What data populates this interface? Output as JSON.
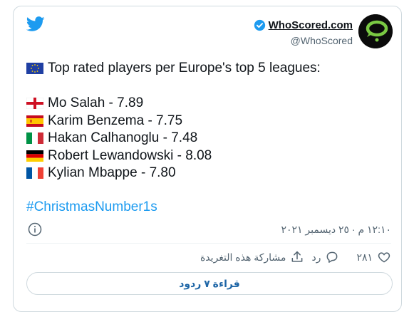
{
  "account": {
    "name": "WhoScored.com",
    "handle": "@WhoScored",
    "verified": true
  },
  "tweet": {
    "headline": "Top rated players per Europe's top 5 leagues:",
    "players": [
      {
        "flag": "england",
        "text": "Mo Salah - 7.89"
      },
      {
        "flag": "spain",
        "text": "Karim Benzema - 7.75"
      },
      {
        "flag": "italy",
        "text": "Hakan Calhanoglu - 7.48"
      },
      {
        "flag": "germany",
        "text": "Robert Lewandowski - 8.08"
      },
      {
        "flag": "france",
        "text": "Kylian Mbappe - 7.80"
      }
    ],
    "hashtag": "#ChristmasNumber1s",
    "date": "١٢:١٠ م · ٢٥ ديسمبر ٢٠٢١"
  },
  "actions": {
    "likes": "٢٨١",
    "reply_label": "رد",
    "share_label": "مشاركة هذه التغريدة",
    "read_replies": "قراءة ٧ ردود"
  },
  "colors": {
    "accent": "#1d9bf0",
    "text": "#0f1419",
    "muted": "#536471"
  }
}
